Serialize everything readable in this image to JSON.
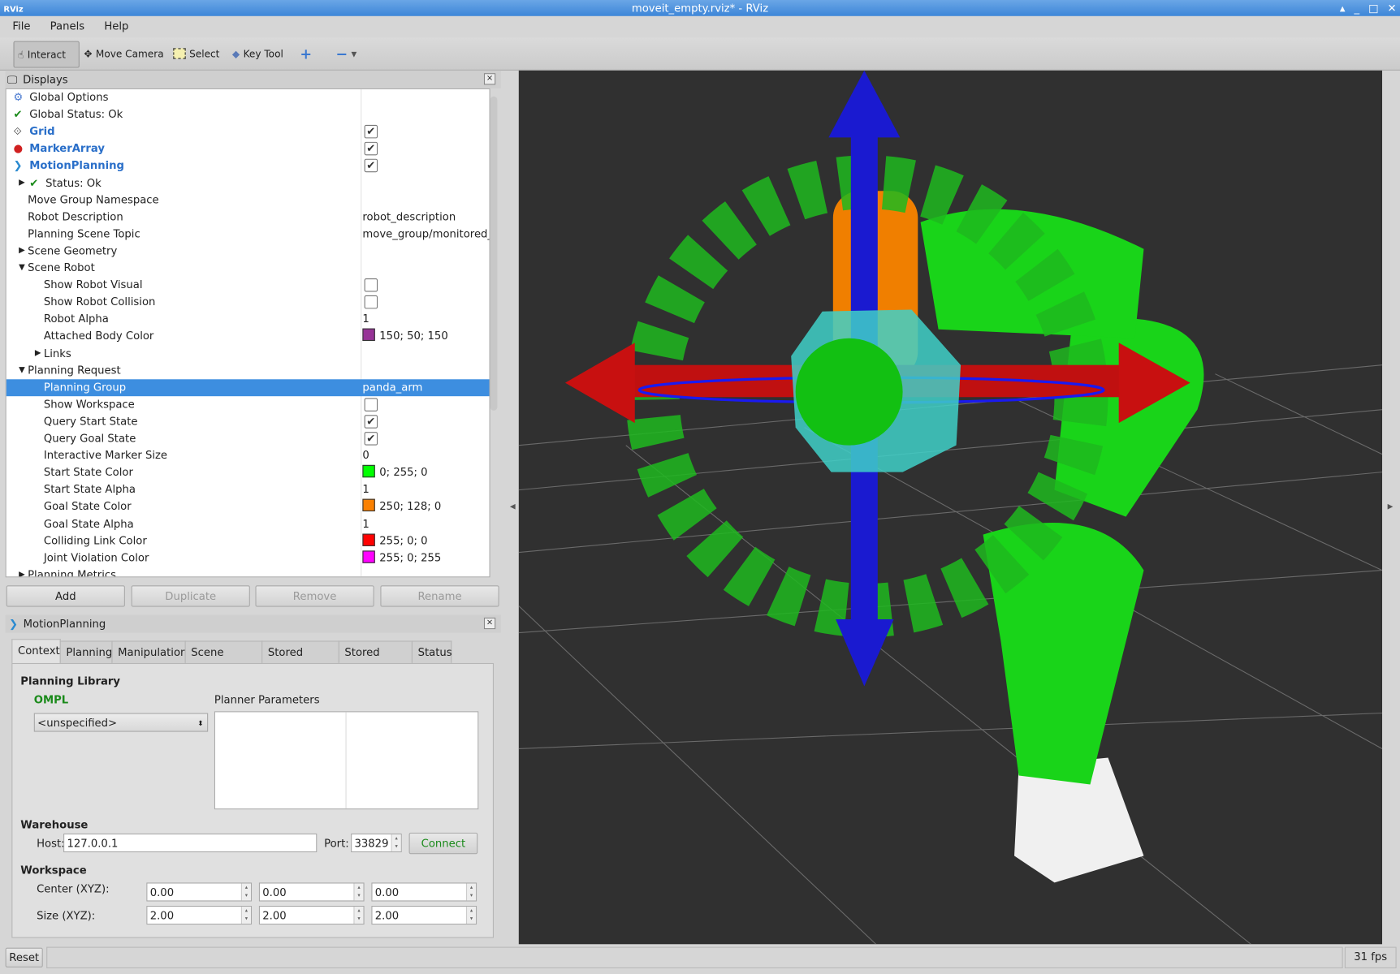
{
  "window": {
    "title": "moveit_empty.rviz* - RViz",
    "logo": "RViz"
  },
  "menu": [
    "File",
    "Panels",
    "Help"
  ],
  "toolbar": {
    "tools": [
      {
        "label": "Interact",
        "icon": "hand-icon",
        "active": true
      },
      {
        "label": "Move Camera",
        "icon": "move-camera-icon"
      },
      {
        "label": "Select",
        "icon": "select-icon"
      },
      {
        "label": "Key Tool",
        "icon": "key-tool-icon"
      }
    ],
    "add_icon": "plus-icon",
    "remove_icon": "minus-icon"
  },
  "displays": {
    "title": "Displays",
    "rows": [
      {
        "label": "Global Options",
        "icon": "gear-icon",
        "level": 0
      },
      {
        "label": "Global Status: Ok",
        "icon": "check-icon",
        "level": 0
      },
      {
        "label": "Grid",
        "icon": "grid-icon",
        "level": 0,
        "blue": true,
        "check": true
      },
      {
        "label": "MarkerArray",
        "icon": "marker-icon",
        "level": 0,
        "blue": true,
        "check": true
      },
      {
        "label": "MotionPlanning",
        "icon": "motionplanning-icon",
        "level": 0,
        "blue": true,
        "check": true
      },
      {
        "label": "Status: Ok",
        "icon": "check-icon",
        "level": 1,
        "expand": "collapsed"
      },
      {
        "label": "Move Group Namespace",
        "level": 1
      },
      {
        "label": "Robot Description",
        "level": 1,
        "value": "robot_description"
      },
      {
        "label": "Planning Scene Topic",
        "level": 1,
        "value": "move_group/monitored_..."
      },
      {
        "label": "Scene Geometry",
        "level": 1,
        "expand": "collapsed"
      },
      {
        "label": "Scene Robot",
        "level": 1,
        "expand": "expanded"
      },
      {
        "label": "Show Robot Visual",
        "level": 2,
        "check": false
      },
      {
        "label": "Show Robot Collision",
        "level": 2,
        "check": false
      },
      {
        "label": "Robot Alpha",
        "level": 2,
        "value": "1"
      },
      {
        "label": "Attached Body Color",
        "level": 2,
        "value": "150; 50; 150",
        "color": "#963296"
      },
      {
        "label": "Links",
        "level": 2,
        "expand": "collapsed"
      },
      {
        "label": "Planning Request",
        "level": 1,
        "expand": "expanded"
      },
      {
        "label": "Planning Group",
        "level": 2,
        "value": "panda_arm",
        "selected": true
      },
      {
        "label": "Show Workspace",
        "level": 2,
        "check": false
      },
      {
        "label": "Query Start State",
        "level": 2,
        "check": true
      },
      {
        "label": "Query Goal State",
        "level": 2,
        "check": true
      },
      {
        "label": "Interactive Marker Size",
        "level": 2,
        "value": "0"
      },
      {
        "label": "Start State Color",
        "level": 2,
        "value": "0; 255; 0",
        "color": "#00ff00"
      },
      {
        "label": "Start State Alpha",
        "level": 2,
        "value": "1"
      },
      {
        "label": "Goal State Color",
        "level": 2,
        "value": "250; 128; 0",
        "color": "#fa8000"
      },
      {
        "label": "Goal State Alpha",
        "level": 2,
        "value": "1"
      },
      {
        "label": "Colliding Link Color",
        "level": 2,
        "value": "255; 0; 0",
        "color": "#ff0000"
      },
      {
        "label": "Joint Violation Color",
        "level": 2,
        "value": "255; 0; 255",
        "color": "#ff00ff"
      },
      {
        "label": "Planning Metrics",
        "level": 1,
        "expand": "collapsed"
      }
    ],
    "buttons": {
      "add": "Add",
      "duplicate": "Duplicate",
      "remove": "Remove",
      "rename": "Rename"
    }
  },
  "motion": {
    "title": "MotionPlanning",
    "tabs": [
      "Context",
      "Planning",
      "Manipulation",
      "Scene Objects",
      "Stored Scenes",
      "Stored States",
      "Status"
    ],
    "active_tab": "Context",
    "planning_library": "Planning Library",
    "library_name": "OMPL",
    "planner": "<unspecified>",
    "planner_params": "Planner Parameters",
    "warehouse": "Warehouse",
    "host_label": "Host:",
    "host": "127.0.0.1",
    "port_label": "Port:",
    "port": "33829",
    "connect": "Connect",
    "workspace": "Workspace",
    "center_label": "Center (XYZ):",
    "center": [
      "0.00",
      "0.00",
      "0.00"
    ],
    "size_label": "Size (XYZ):",
    "size": [
      "2.00",
      "2.00",
      "2.00"
    ]
  },
  "status": {
    "reset": "Reset",
    "fps": "31 fps"
  },
  "colors": {
    "accent": "#3d8ee0",
    "connect": "#1a8a1a",
    "ok_green": "#1a8a1a"
  }
}
